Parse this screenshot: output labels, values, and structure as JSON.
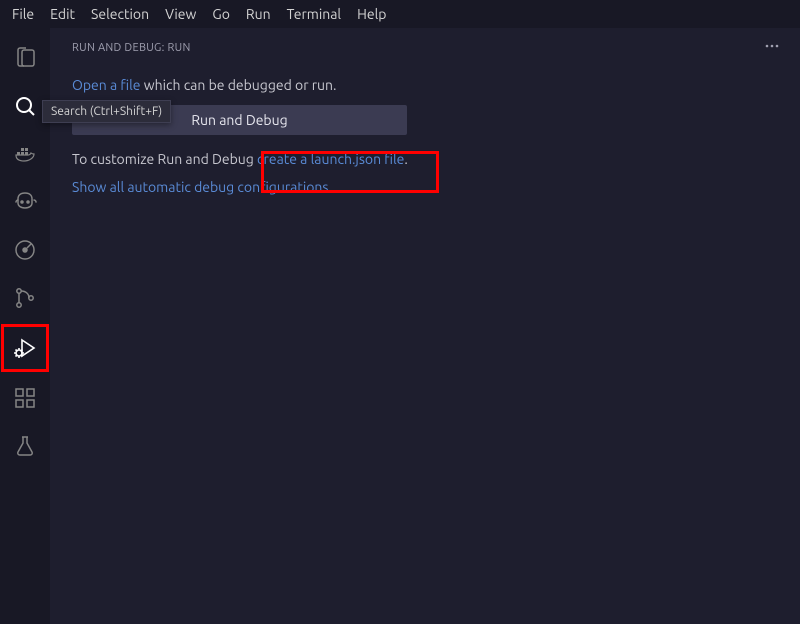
{
  "menubar": [
    "File",
    "Edit",
    "Selection",
    "View",
    "Go",
    "Run",
    "Terminal",
    "Help"
  ],
  "tooltip": {
    "text": "Search (Ctrl+Shift+F)"
  },
  "sidebar": {
    "title": "RUN AND DEBUG: RUN",
    "line1": {
      "link": "Open a file",
      "rest": " which can be debugged or run."
    },
    "run_button_label": "Run and Debug",
    "line2": {
      "prefix": "To customize Run and Debug ",
      "link": "create a launch.json file",
      "suffix": "."
    },
    "line3": {
      "link": "Show all automatic debug configurations",
      "suffix": "."
    }
  },
  "icons": {
    "explorer": "files-icon",
    "search": "search-icon",
    "docker": "docker-icon",
    "copilot": "copilot-icon",
    "remote": "remote-icon",
    "scm": "source-control-icon",
    "debug": "run-debug-icon",
    "extensions": "extensions-icon",
    "test": "testing-icon",
    "more": "ellipsis-icon"
  }
}
